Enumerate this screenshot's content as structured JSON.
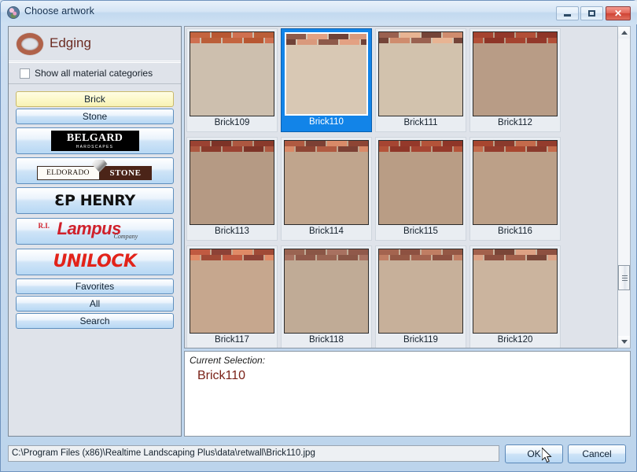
{
  "window": {
    "title": "Choose artwork",
    "icon": "app-icon",
    "controls": {
      "minimize": "minimize-icon",
      "maximize": "maximize-icon",
      "close": "✕"
    }
  },
  "sidebar": {
    "header": {
      "icon": "edging-ring-icon",
      "title": "Edging"
    },
    "show_all": {
      "label": "Show all material categories",
      "checked": false
    },
    "categories": [
      {
        "label": "Brick",
        "type": "text",
        "selected": true
      },
      {
        "label": "Stone",
        "type": "text",
        "selected": false
      },
      {
        "label": "BELGARD",
        "type": "logo",
        "logo": "belgard",
        "sub": "HARDSCAPES",
        "selected": false
      },
      {
        "label": "ELDORADO STONE",
        "type": "logo",
        "logo": "eldorado",
        "left": "ELDORADO",
        "right": "STONE",
        "selected": false
      },
      {
        "label": "EP HENRY",
        "type": "logo",
        "logo": "ephenry",
        "text": "ƐP HENRY",
        "selected": false
      },
      {
        "label": "R.I. Lampus Company",
        "type": "logo",
        "logo": "lampus",
        "pre": "R.I.",
        "main": "Lampus",
        "sub": "Company",
        "selected": false
      },
      {
        "label": "UNILOCK",
        "type": "logo",
        "logo": "unilock",
        "text": "UNILOCK",
        "selected": false
      },
      {
        "label": "Favorites",
        "type": "text",
        "selected": false
      },
      {
        "label": "All",
        "type": "text",
        "selected": false
      },
      {
        "label": "Search",
        "type": "text",
        "selected": false
      }
    ]
  },
  "grid": {
    "selected_index": 1,
    "items": [
      {
        "label": "Brick109",
        "mortar": "#cdbfae",
        "b1": "#c4643f",
        "b2": "#b85732",
        "b3": "#cf7050",
        "b4": "#bb5e38"
      },
      {
        "label": "Brick110",
        "mortar": "#d8c8b4",
        "b1": "#8e5a4a",
        "b2": "#e3a183",
        "b3": "#6f4238",
        "b4": "#d9997c"
      },
      {
        "label": "Brick111",
        "mortar": "#d2c2ad",
        "b1": "#9a6150",
        "b2": "#e8b493",
        "b3": "#744438",
        "b4": "#cf8c6e"
      },
      {
        "label": "Brick112",
        "mortar": "#b89c86",
        "b1": "#a5432f",
        "b2": "#93382a",
        "b3": "#b24f37",
        "b4": "#8e3527"
      },
      {
        "label": "Brick113",
        "mortar": "#b59a84",
        "b1": "#9b4232",
        "b2": "#7d3327",
        "b3": "#ad5740",
        "b4": "#8a3a2b"
      },
      {
        "label": "Brick114",
        "mortar": "#c0a58d",
        "b1": "#b05a41",
        "b2": "#7c4034",
        "b3": "#d98a68",
        "b4": "#8e4534"
      },
      {
        "label": "Brick115",
        "mortar": "#b99d85",
        "b1": "#a64532",
        "b2": "#95392a",
        "b3": "#b45339",
        "b4": "#8f3628"
      },
      {
        "label": "Brick116",
        "mortar": "#bca088",
        "b1": "#a8462f",
        "b2": "#8a3a2c",
        "b3": "#c46a4b",
        "b4": "#943c2d"
      },
      {
        "label": "Brick117",
        "mortar": "#c6a78e",
        "b1": "#c05a41",
        "b2": "#8d4236",
        "b3": "#e08a66",
        "b4": "#a04a36"
      },
      {
        "label": "Brick118",
        "mortar": "#c0ab96",
        "b1": "#9a6452",
        "b2": "#8a5646",
        "b3": "#a87160",
        "b4": "#90594a"
      },
      {
        "label": "Brick119",
        "mortar": "#c7b09a",
        "b1": "#a4644f",
        "b2": "#8d5141",
        "b3": "#c07e63",
        "b4": "#945845"
      },
      {
        "label": "Brick120",
        "mortar": "#cbb49e",
        "b1": "#a3614c",
        "b2": "#7a4638",
        "b3": "#dda184",
        "b4": "#8d5040"
      }
    ]
  },
  "scrollbar": {
    "up_icon": "scroll-up-arrow-icon",
    "down_icon": "scroll-down-arrow-icon",
    "thumb_position_percent": 78
  },
  "selection": {
    "caption": "Current Selection:",
    "value": "Brick110"
  },
  "footer": {
    "path": "C:\\Program Files (x86)\\Realtime Landscaping Plus\\data\\retwall\\Brick110.jpg",
    "ok_label": "OK",
    "cancel_label": "Cancel"
  }
}
